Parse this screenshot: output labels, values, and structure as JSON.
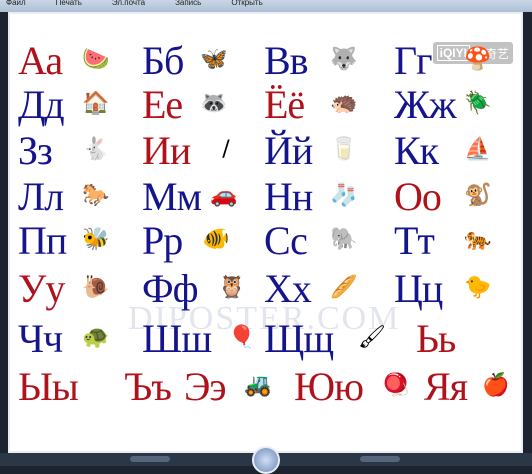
{
  "menubar": {
    "items": [
      "Файл",
      "Печать",
      "Эл.почта",
      "Запись",
      "Открыть"
    ]
  },
  "logo": {
    "box": "iQIYI",
    "text": "爱奇艺"
  },
  "watermark": "DIPOSTER.COM",
  "colors": {
    "blue": "#14148c",
    "red": "#b0121b"
  },
  "alphabet": [
    {
      "letters": "Аа",
      "color": "red",
      "picture": "watermelon-icon",
      "glyph": "🍉"
    },
    {
      "letters": "Бб",
      "color": "blue",
      "picture": "butterfly-icon",
      "glyph": "🦋"
    },
    {
      "letters": "Вв",
      "color": "blue",
      "picture": "wolf-icon",
      "glyph": "🐺"
    },
    {
      "letters": "Гг",
      "color": "blue",
      "picture": "mushrooms-icon",
      "glyph": "🍄"
    },
    {
      "letters": "Дд",
      "color": "blue",
      "picture": "house-icon",
      "glyph": "🏠"
    },
    {
      "letters": "Ее",
      "color": "red",
      "picture": "raccoon-icon",
      "glyph": "🦝"
    },
    {
      "letters": "Ёё",
      "color": "red",
      "picture": "hedgehog-icon",
      "glyph": "🦔"
    },
    {
      "letters": "Жж",
      "color": "blue",
      "picture": "beetle-icon",
      "glyph": "🪲"
    },
    {
      "letters": "Зз",
      "color": "blue",
      "picture": "rabbit-icon",
      "glyph": "🐇"
    },
    {
      "letters": "Ии",
      "color": "red",
      "picture": "needle-icon",
      "glyph": "/"
    },
    {
      "letters": "Йй",
      "color": "blue",
      "picture": "yogurt-icon",
      "glyph": "🥛"
    },
    {
      "letters": "Кк",
      "color": "blue",
      "picture": "ship-icon",
      "glyph": "⛵"
    },
    {
      "letters": "Лл",
      "color": "blue",
      "picture": "horse-icon",
      "glyph": "🐎"
    },
    {
      "letters": "Мм",
      "color": "blue",
      "picture": "car-icon",
      "glyph": "🚗"
    },
    {
      "letters": "Нн",
      "color": "blue",
      "picture": "socks-icon",
      "glyph": "🧦"
    },
    {
      "letters": "Оо",
      "color": "red",
      "picture": "monkey-icon",
      "glyph": "🐒"
    },
    {
      "letters": "Пп",
      "color": "blue",
      "picture": "bee-icon",
      "glyph": "🐝"
    },
    {
      "letters": "Рр",
      "color": "blue",
      "picture": "fish-icon",
      "glyph": "🐠"
    },
    {
      "letters": "Сс",
      "color": "blue",
      "picture": "elephant-icon",
      "glyph": "🐘"
    },
    {
      "letters": "Тт",
      "color": "blue",
      "picture": "tiger-icon",
      "glyph": "🐅"
    },
    {
      "letters": "Уу",
      "color": "red",
      "picture": "snail-icon",
      "glyph": "🐌"
    },
    {
      "letters": "Фф",
      "color": "blue",
      "picture": "owl-icon",
      "glyph": "🦉"
    },
    {
      "letters": "Хх",
      "color": "blue",
      "picture": "bread-icon",
      "glyph": "🥖"
    },
    {
      "letters": "Цц",
      "color": "blue",
      "picture": "chick-icon",
      "glyph": "🐤"
    },
    {
      "letters": "Чч",
      "color": "blue",
      "picture": "turtle-icon",
      "glyph": "🐢"
    },
    {
      "letters": "Шш",
      "color": "blue",
      "picture": "balloon-icon",
      "glyph": "🎈"
    },
    {
      "letters": "Щщ",
      "color": "blue",
      "picture": "brush-icon",
      "glyph": "🖌"
    },
    {
      "letters": "Ьь",
      "color": "red",
      "picture": "",
      "glyph": ""
    },
    {
      "letters": "Ыы",
      "color": "red",
      "picture": "",
      "glyph": ""
    },
    {
      "letters": "Ъъ",
      "color": "red",
      "picture": "",
      "glyph": ""
    },
    {
      "letters": "Ээ",
      "color": "red",
      "picture": "excavator-icon",
      "glyph": "🚜"
    },
    {
      "letters": "Юю",
      "color": "red",
      "picture": "spinning-top-icon",
      "glyph": "🪀"
    },
    {
      "letters": "Яя",
      "color": "red",
      "picture": "apple-icon",
      "glyph": "🍎"
    }
  ]
}
